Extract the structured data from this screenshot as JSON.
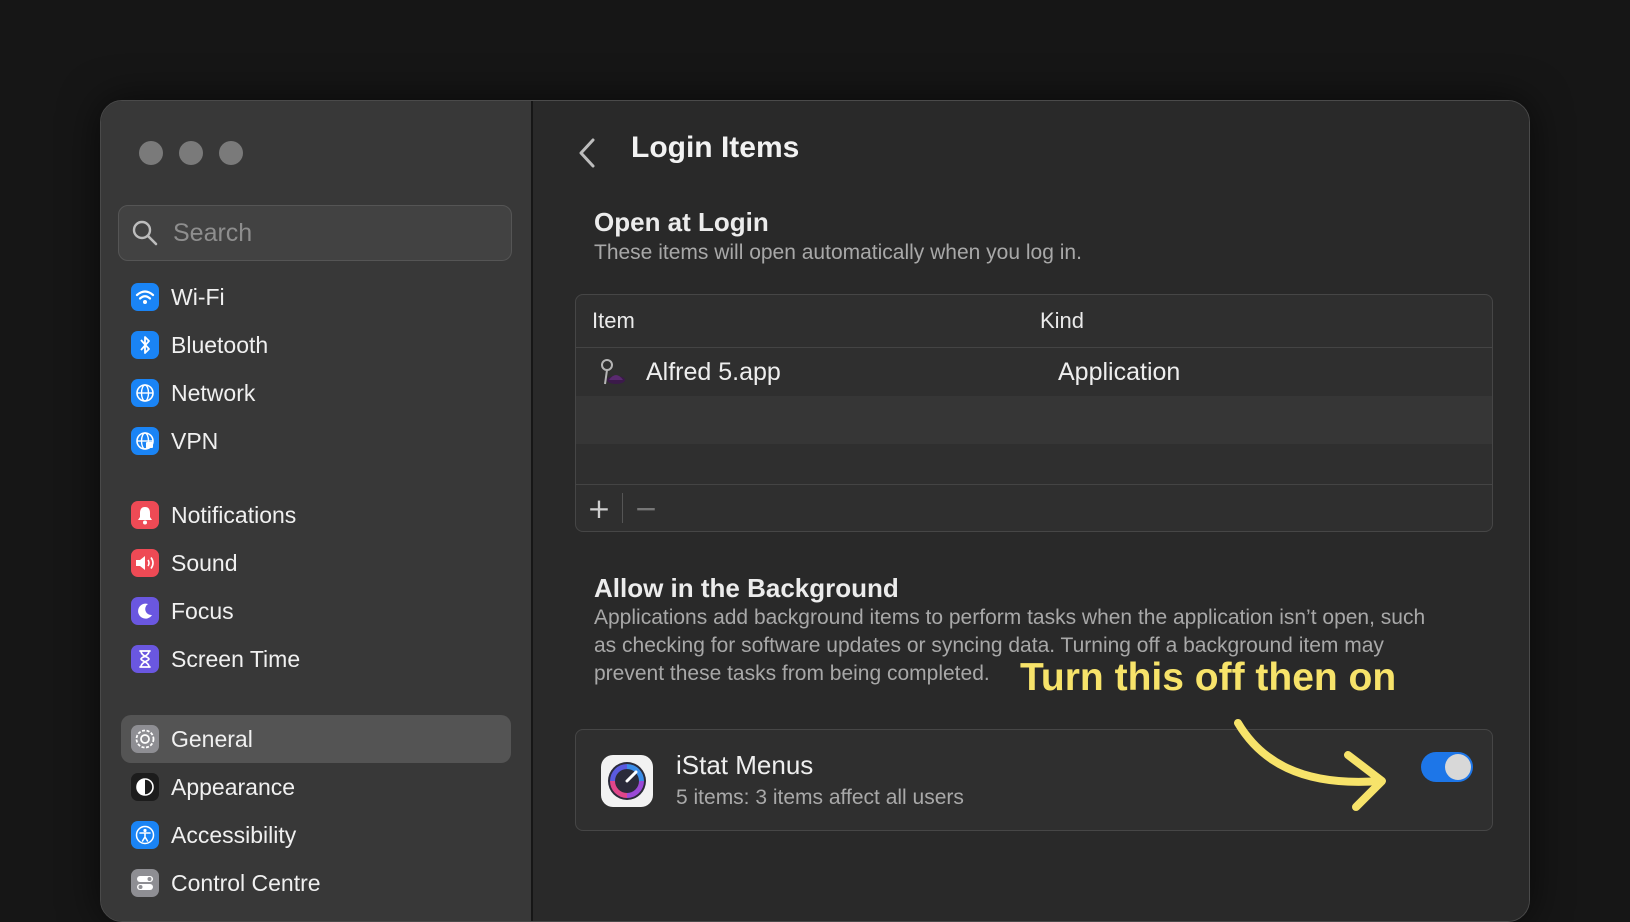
{
  "sidebar": {
    "search_placeholder": "Search",
    "groups": [
      [
        {
          "label": "Wi-Fi",
          "icon": "wifi-icon",
          "color": "#1a84f5"
        },
        {
          "label": "Bluetooth",
          "icon": "bluetooth-icon",
          "color": "#1a84f5"
        },
        {
          "label": "Network",
          "icon": "globe-icon",
          "color": "#1a84f5"
        },
        {
          "label": "VPN",
          "icon": "vpn-globe-icon",
          "color": "#1a84f5"
        }
      ],
      [
        {
          "label": "Notifications",
          "icon": "bell-icon",
          "color": "#ee4a55"
        },
        {
          "label": "Sound",
          "icon": "speaker-icon",
          "color": "#ee4a55"
        },
        {
          "label": "Focus",
          "icon": "moon-icon",
          "color": "#6a57e0"
        },
        {
          "label": "Screen Time",
          "icon": "hourglass-icon",
          "color": "#6a57e0"
        }
      ],
      [
        {
          "label": "General",
          "icon": "gear-icon",
          "color": "#8e8e93",
          "selected": true
        },
        {
          "label": "Appearance",
          "icon": "appearance-icon",
          "color": "#1c1c1c"
        },
        {
          "label": "Accessibility",
          "icon": "accessibility-icon",
          "color": "#1a84f5"
        },
        {
          "label": "Control Centre",
          "icon": "control-centre-icon",
          "color": "#8e8e93"
        }
      ]
    ]
  },
  "main": {
    "title": "Login Items",
    "open_at_login": {
      "title": "Open at Login",
      "description": "These items will open automatically when you log in.",
      "columns": [
        "Item",
        "Kind"
      ],
      "rows": [
        {
          "name": "Alfred 5.app",
          "kind": "Application",
          "icon": "alfred-icon"
        }
      ],
      "add_label": "+",
      "remove_label": "−"
    },
    "background": {
      "title": "Allow in the Background",
      "description": "Applications add background items to perform tasks when the application isn’t open, such as checking for software updates or syncing data. Turning off a background item may prevent these tasks from being completed.",
      "items": [
        {
          "name": "iStat Menus",
          "subtitle": "5 items: 3 items affect all users",
          "enabled": true,
          "icon": "istat-menus-icon"
        }
      ]
    }
  },
  "annotation": {
    "text": "Turn this off then on",
    "color": "#f7e36a"
  },
  "colors": {
    "accent": "#1d76e8"
  }
}
